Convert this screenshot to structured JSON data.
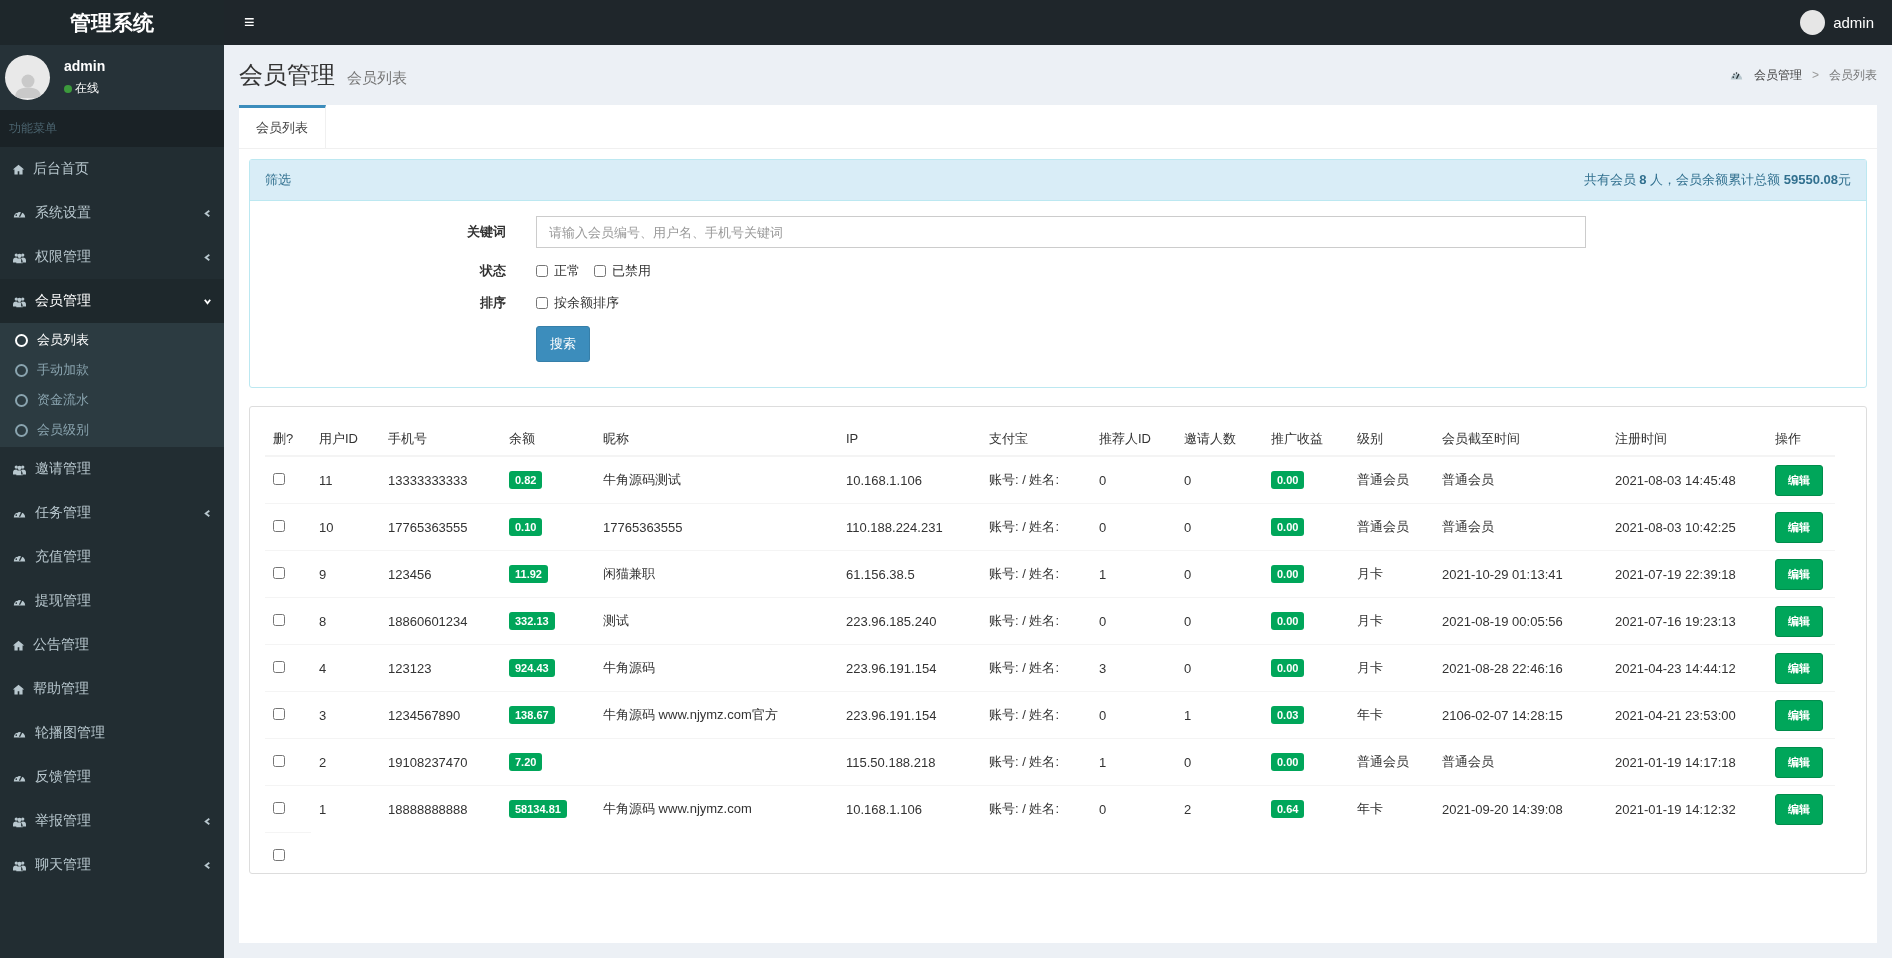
{
  "header": {
    "brand": "管理系统",
    "menu_toggle": "≡",
    "user": "admin"
  },
  "sidebar": {
    "user": {
      "name": "admin",
      "status": "在线"
    },
    "menu_header": "功能菜单",
    "items": [
      {
        "label": "后台首页",
        "kind": "home",
        "expandable": false,
        "expanded": false
      },
      {
        "label": "系统设置",
        "kind": "dashboard",
        "expandable": true,
        "expanded": false
      },
      {
        "label": "权限管理",
        "kind": "users",
        "expandable": true,
        "expanded": false
      },
      {
        "label": "会员管理",
        "kind": "users",
        "expandable": true,
        "expanded": true,
        "children": [
          {
            "label": "会员列表",
            "selected": true
          },
          {
            "label": "手动加款",
            "selected": false
          },
          {
            "label": "资金流水",
            "selected": false
          },
          {
            "label": "会员级别",
            "selected": false
          }
        ]
      },
      {
        "label": "邀请管理",
        "kind": "users",
        "expandable": false,
        "expanded": false
      },
      {
        "label": "任务管理",
        "kind": "dashboard",
        "expandable": true,
        "expanded": false
      },
      {
        "label": "充值管理",
        "kind": "dashboard",
        "expandable": false,
        "expanded": false
      },
      {
        "label": "提现管理",
        "kind": "dashboard",
        "expandable": false,
        "expanded": false
      },
      {
        "label": "公告管理",
        "kind": "home",
        "expandable": false,
        "expanded": false
      },
      {
        "label": "帮助管理",
        "kind": "home",
        "expandable": false,
        "expanded": false
      },
      {
        "label": "轮播图管理",
        "kind": "dashboard",
        "expandable": false,
        "expanded": false
      },
      {
        "label": "反馈管理",
        "kind": "dashboard",
        "expandable": false,
        "expanded": false
      },
      {
        "label": "举报管理",
        "kind": "users",
        "expandable": true,
        "expanded": false
      },
      {
        "label": "聊天管理",
        "kind": "users",
        "expandable": true,
        "expanded": false
      }
    ]
  },
  "page": {
    "title": "会员管理",
    "subtitle": "会员列表",
    "breadcrumb": [
      "会员管理",
      "会员列表"
    ],
    "breadcrumb_separator": ">"
  },
  "tabs": [
    {
      "label": "会员列表",
      "selected": true
    }
  ],
  "filter": {
    "title": "筛选",
    "summary": "共有会员 **8** 人，会员余额累计总额 **59550.08**元",
    "keyword": {
      "label": "关键词",
      "placeholder": "请输入会员编号、用户名、手机号关键词"
    },
    "status": {
      "label": "状态",
      "options": [
        {
          "label": "正常",
          "checked": false
        },
        {
          "label": "已禁用",
          "checked": false
        }
      ]
    },
    "sort": {
      "label": "排序",
      "options": [
        {
          "label": "按余额排序",
          "checked": false
        }
      ]
    },
    "search_button": "搜索"
  },
  "table": {
    "columns": [
      "删?",
      "用户ID",
      "手机号",
      "余额",
      "昵称",
      "IP",
      "支付宝",
      "推荐人ID",
      "邀请人数",
      "推广收益",
      "级别",
      "会员截至时间",
      "注册时间",
      "操作"
    ],
    "rows": [
      {
        "checked": false,
        "id": "11",
        "phone": "13333333333",
        "balance": "0.82",
        "nickname": "牛角源码测试",
        "ip": "10.168.1.106",
        "alipay": "账号: / 姓名:",
        "referrer_id": "0",
        "invites": "0",
        "earnings": "0.00",
        "level": "普通会员",
        "expires": "普通会员",
        "registered": "2021-08-03 14:45:48",
        "action": "编辑"
      },
      {
        "checked": false,
        "id": "10",
        "phone": "17765363555",
        "balance": "0.10",
        "nickname": "17765363555",
        "ip": "110.188.224.231",
        "alipay": "账号: / 姓名:",
        "referrer_id": "0",
        "invites": "0",
        "earnings": "0.00",
        "level": "普通会员",
        "expires": "普通会员",
        "registered": "2021-08-03 10:42:25",
        "action": "编辑"
      },
      {
        "checked": false,
        "id": "9",
        "phone": "123456",
        "balance": "11.92",
        "nickname": "闲猫兼职",
        "ip": "61.156.38.5",
        "alipay": "账号: / 姓名:",
        "referrer_id": "1",
        "invites": "0",
        "earnings": "0.00",
        "level": "月卡",
        "expires": "2021-10-29 01:13:41",
        "registered": "2021-07-19 22:39:18",
        "action": "编辑"
      },
      {
        "checked": false,
        "id": "8",
        "phone": "18860601234",
        "balance": "332.13",
        "nickname": "测试",
        "ip": "223.96.185.240",
        "alipay": "账号: / 姓名:",
        "referrer_id": "0",
        "invites": "0",
        "earnings": "0.00",
        "level": "月卡",
        "expires": "2021-08-19 00:05:56",
        "registered": "2021-07-16 19:23:13",
        "action": "编辑"
      },
      {
        "checked": false,
        "id": "4",
        "phone": "123123",
        "balance": "924.43",
        "nickname": "牛角源码",
        "ip": "223.96.191.154",
        "alipay": "账号: / 姓名:",
        "referrer_id": "3",
        "invites": "0",
        "earnings": "0.00",
        "level": "月卡",
        "expires": "2021-08-28 22:46:16",
        "registered": "2021-04-23 14:44:12",
        "action": "编辑"
      },
      {
        "checked": false,
        "id": "3",
        "phone": "1234567890",
        "balance": "138.67",
        "nickname": "牛角源码 www.njymz.com官方",
        "ip": "223.96.191.154",
        "alipay": "账号: / 姓名:",
        "referrer_id": "0",
        "invites": "1",
        "earnings": "0.03",
        "level": "年卡",
        "expires": "2106-02-07 14:28:15",
        "registered": "2021-04-21 23:53:00",
        "action": "编辑"
      },
      {
        "checked": false,
        "id": "2",
        "phone": "19108237470",
        "balance": "7.20",
        "ip": "115.50.188.218",
        "alipay": "账号: / 姓名:",
        "referrer_id": "1",
        "invites": "0",
        "earnings": "0.00",
        "level": "普通会员",
        "expires": "普通会员",
        "registered": "2021-01-19 14:17:18",
        "action": "编辑"
      },
      {
        "checked": false,
        "id": "1",
        "phone": "18888888888",
        "balance": "58134.81",
        "nickname": "牛角源码 www.njymz.com",
        "ip": "10.168.1.106",
        "alipay": "账号: / 姓名:",
        "referrer_id": "0",
        "invites": "2",
        "earnings": "0.64",
        "level": "年卡",
        "expires": "2021-09-20 14:39:08",
        "registered": "2021-01-19 14:12:32",
        "action": "编辑"
      }
    ],
    "select_all": {
      "checked": false
    }
  }
}
